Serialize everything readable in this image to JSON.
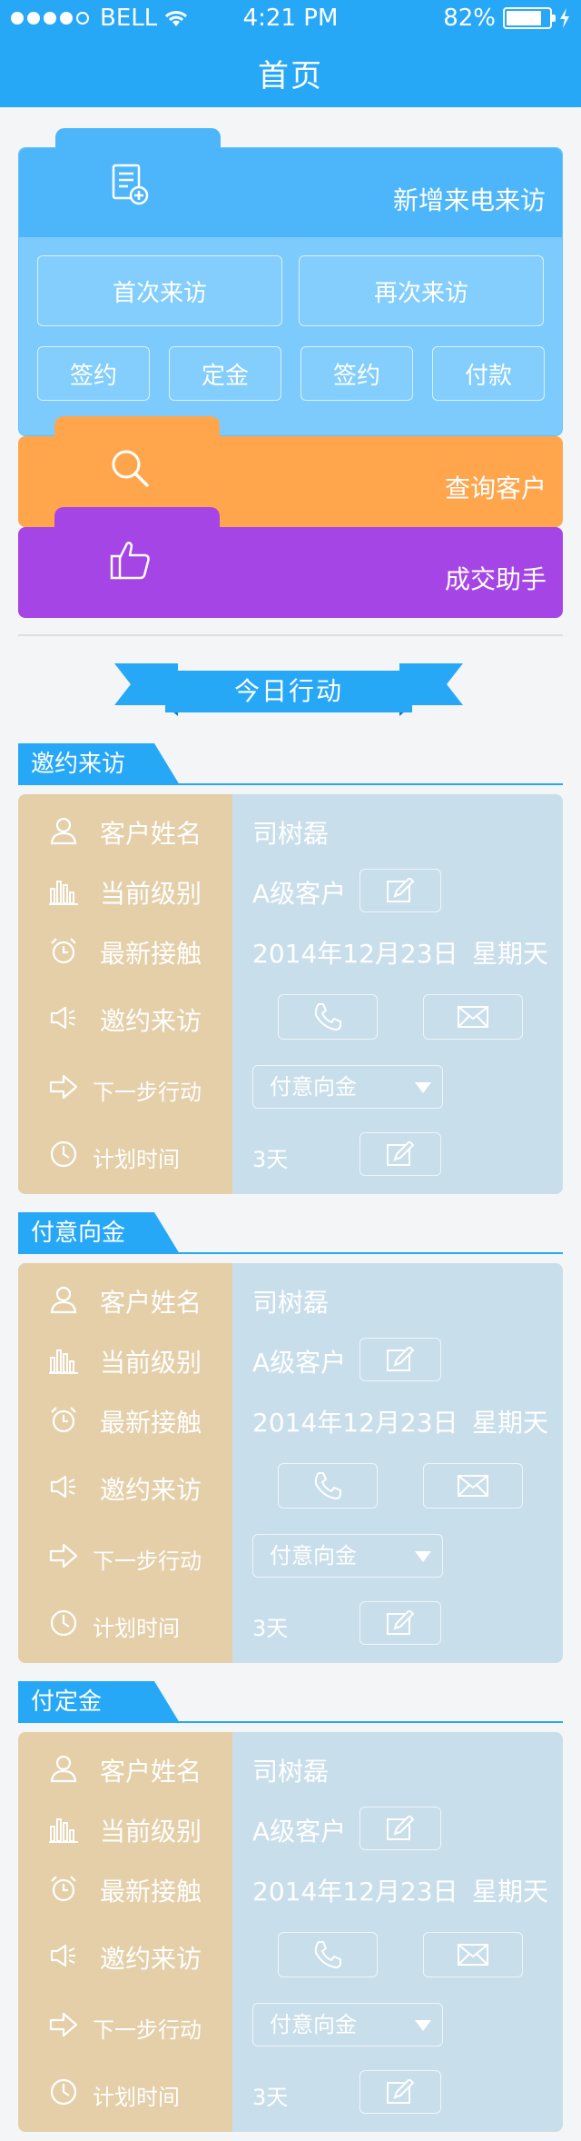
{
  "status_bar": {
    "carrier": "BELL",
    "time": "4:21 PM",
    "battery": "82%"
  },
  "nav": {
    "title": "首页"
  },
  "new_visit": {
    "title": "新增来电来访",
    "buttons": [
      "首次来访",
      "再次来访"
    ],
    "small_buttons": [
      "签约",
      "定金",
      "签约",
      "付款"
    ]
  },
  "search": {
    "title": "查询客户"
  },
  "deal": {
    "title": "成交助手"
  },
  "today": {
    "title": "今日行动"
  },
  "sections": [
    {
      "label": "邀约来访",
      "rows": {
        "name_label": "客户姓名",
        "name_value": "司树磊",
        "level_label": "当前级别",
        "level_value": "A级客户",
        "contact_label": "最新接触",
        "contact_date": "2014年12月23日",
        "contact_weekday": "星期天",
        "invite_label": "邀约来访",
        "next_label": "下一步行动",
        "next_value": "付意向金",
        "plan_label": "计划时间",
        "plan_value": "3天"
      }
    },
    {
      "label": "付意向金",
      "rows": {
        "name_label": "客户姓名",
        "name_value": "司树磊",
        "level_label": "当前级别",
        "level_value": "A级客户",
        "contact_label": "最新接触",
        "contact_date": "2014年12月23日",
        "contact_weekday": "星期天",
        "invite_label": "邀约来访",
        "next_label": "下一步行动",
        "next_value": "付意向金",
        "plan_label": "计划时间",
        "plan_value": "3天"
      }
    },
    {
      "label": "付定金",
      "rows": {
        "name_label": "客户姓名",
        "name_value": "司树磊",
        "level_label": "当前级别",
        "level_value": "A级客户",
        "contact_label": "最新接触",
        "contact_date": "2014年12月23日",
        "contact_weekday": "星期天",
        "invite_label": "邀约来访",
        "next_label": "下一步行动",
        "next_value": "付意向金",
        "plan_label": "计划时间",
        "plan_value": "3天"
      }
    }
  ],
  "colors": {
    "primary": "#27a8f6",
    "new_visit": "#4db6fa",
    "search": "#ffa64d",
    "deal": "#a545e5",
    "card_left": "#e4cfa9",
    "card_right": "#c9deeb"
  }
}
